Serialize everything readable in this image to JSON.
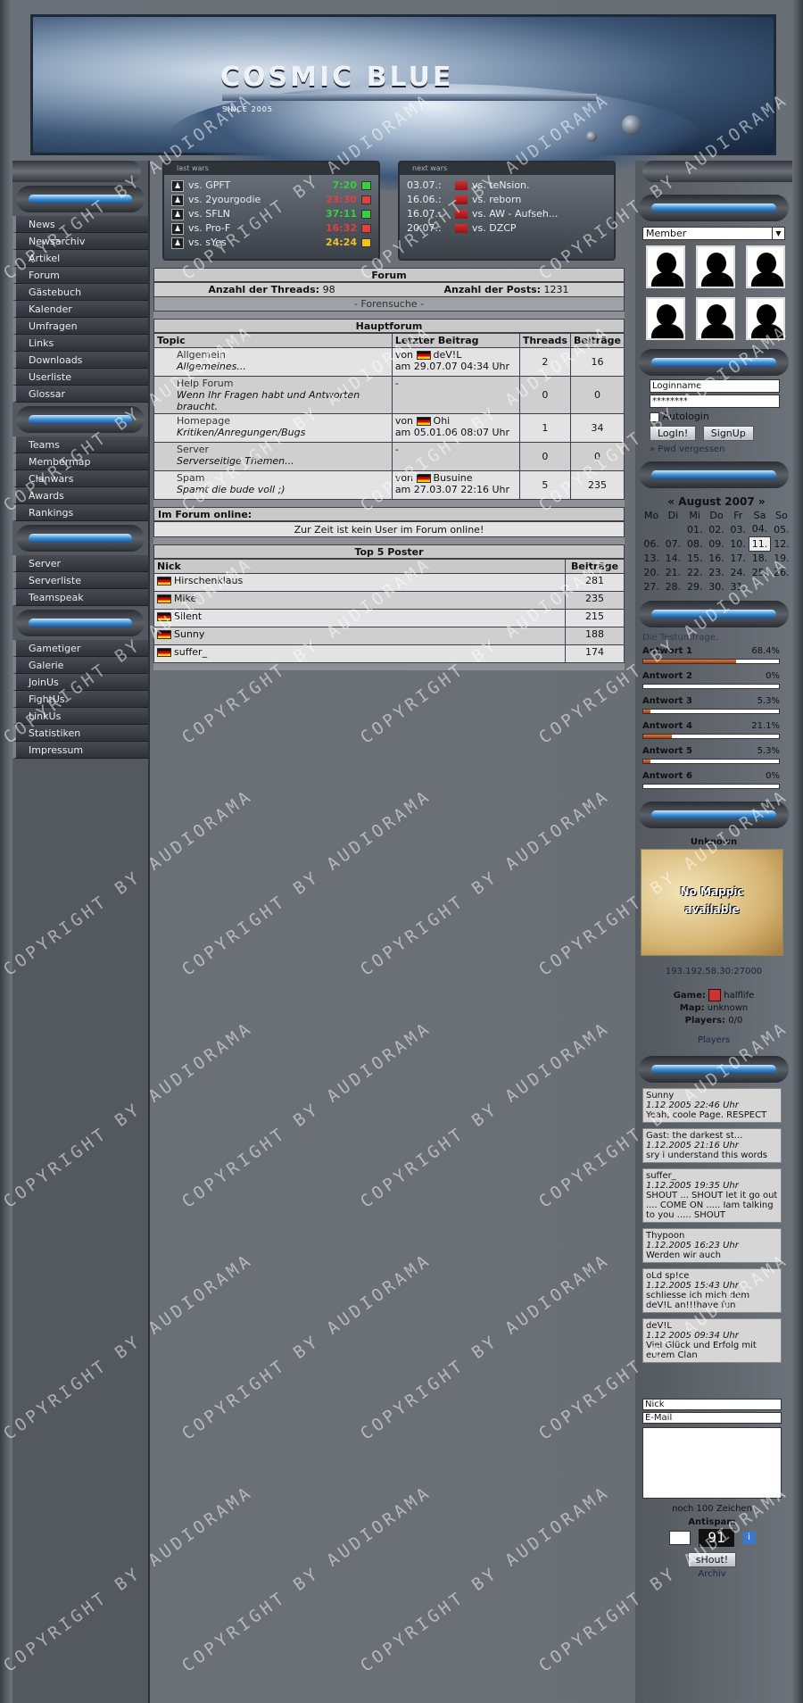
{
  "header": {
    "logo": "COSMIC BLUE",
    "since": "SINCE 2005"
  },
  "watermark": "COPYRIGHT BY AUDIORAMA",
  "left_nav_1": [
    "News",
    "Newsarchiv",
    "Artikel",
    "Forum",
    "Gästebuch",
    "Kalender",
    "Umfragen",
    "Links",
    "Downloads",
    "Userliste",
    "Glossar"
  ],
  "left_nav_2": [
    "Teams",
    "Membermap",
    "Clanwars",
    "Awards",
    "Rankings"
  ],
  "left_nav_3": [
    "Server",
    "Serverliste",
    "Teamspeak"
  ],
  "left_nav_4": [
    "Gametiger",
    "Galerie",
    "JoinUs",
    "FightUs",
    "LinkUs",
    "Statistiken",
    "Impressum"
  ],
  "last_wars": {
    "title": "last wars",
    "rows": [
      {
        "opp": "vs. GPFT",
        "score": "7:20",
        "color": "#39d03b"
      },
      {
        "opp": "vs. 2yourgodie",
        "score": "23:30",
        "color": "#e24040"
      },
      {
        "opp": "vs. SFLN",
        "score": "37:11",
        "color": "#39d03b"
      },
      {
        "opp": "vs. Pro-F",
        "score": "16:32",
        "color": "#e24040"
      },
      {
        "opp": "vs. sYes",
        "score": "24:24",
        "color": "#f0c420"
      }
    ]
  },
  "next_wars": {
    "title": "next wars",
    "rows": [
      {
        "date": "03.07.:",
        "opp": "vs. teNsion."
      },
      {
        "date": "16.06.:",
        "opp": "vs. reborn"
      },
      {
        "date": "16.07.:",
        "opp": "vs. AW - Aufseh..."
      },
      {
        "date": "20.07.:",
        "opp": "vs. DZCP"
      }
    ]
  },
  "forum": {
    "title": "Forum",
    "threads_label": "Anzahl der Threads:",
    "threads": "98",
    "posts_label": "Anzahl der Posts:",
    "posts": "1231",
    "search": "- Forensuche -",
    "main_title": "Hauptforum",
    "col_topic": "Topic",
    "col_last": "Letzter Beitrag",
    "col_threads": "Threads",
    "col_posts": "Beiträge",
    "rows": [
      {
        "name": "Allgemein",
        "desc": "Allgemeines...",
        "l1": "von",
        "user": "deV!L",
        "l2": "am 29.07.07 04:34 Uhr",
        "threads": "2",
        "posts": "16"
      },
      {
        "name": "Help Forum",
        "desc": "Wenn Ihr Fragen habt und Antworten braucht.",
        "l1": "-",
        "user": "",
        "l2": "",
        "threads": "0",
        "posts": "0"
      },
      {
        "name": "Homepage",
        "desc": "Kritiken/Anregungen/Bugs",
        "l1": "von",
        "user": "Ohi",
        "l2": "am 05.01.06 08:07 Uhr",
        "threads": "1",
        "posts": "34"
      },
      {
        "name": "Server",
        "desc": "Serverseitige Themen...",
        "l1": "-",
        "user": "",
        "l2": "",
        "threads": "0",
        "posts": "0"
      },
      {
        "name": "Spam",
        "desc": "Spamt die bude voll ;)",
        "l1": "von",
        "user": "Busuine",
        "l2": "am 27.03.07 22:16 Uhr",
        "threads": "5",
        "posts": "235"
      }
    ],
    "online_title": "Im Forum online:",
    "online_text": "Zur Zeit ist kein User im Forum online!",
    "top_title": "Top 5 Poster",
    "top_nick": "Nick",
    "top_posts": "Beiträge",
    "top": [
      {
        "nick": "Hirschenklaus",
        "posts": "281"
      },
      {
        "nick": "Mike",
        "posts": "235"
      },
      {
        "nick": "Silent",
        "posts": "215"
      },
      {
        "nick": "Sunny",
        "posts": "188"
      },
      {
        "nick": "suffer_",
        "posts": "174"
      }
    ]
  },
  "members": {
    "select": "Member"
  },
  "login": {
    "name": "Loginname",
    "pass": "********",
    "autologin": "Autologin",
    "login_btn": "LogIn!",
    "signup_btn": "SignUp",
    "forgot": "» Pwd vergessen"
  },
  "calendar": {
    "title": "« August 2007 »",
    "days": [
      "Mo",
      "Di",
      "Mi",
      "Do",
      "Fr",
      "Sa",
      "So"
    ],
    "weeks": [
      [
        "",
        "",
        "01.",
        "02.",
        "03.",
        "04.",
        "05."
      ],
      [
        "06.",
        "07.",
        "08.",
        "09.",
        "10.",
        "11.",
        "12."
      ],
      [
        "13.",
        "14.",
        "15.",
        "16.",
        "17.",
        "18.",
        "19."
      ],
      [
        "20.",
        "21.",
        "22.",
        "23.",
        "24.",
        "25.",
        "26."
      ],
      [
        "27.",
        "28.",
        "29.",
        "30.",
        "31.",
        "",
        ""
      ]
    ]
  },
  "poll": {
    "question": "Die Testumfrage.",
    "answers": [
      {
        "label": "Antwort 1",
        "pct": "68.4%",
        "value": 68.4
      },
      {
        "label": "Antwort 2",
        "pct": "0%",
        "value": 0
      },
      {
        "label": "Antwort 3",
        "pct": "5.3%",
        "value": 5.3
      },
      {
        "label": "Antwort 4",
        "pct": "21.1%",
        "value": 21.1
      },
      {
        "label": "Antwort 5",
        "pct": "5.3%",
        "value": 5.3
      },
      {
        "label": "Antwort 6",
        "pct": "0%",
        "value": 0
      }
    ]
  },
  "server": {
    "name": "Unknown",
    "map_line1": "No Mappic",
    "map_line2": "available",
    "ip": "193.192.58.30:27000",
    "game_label": "Game:",
    "game": "halflife",
    "map_label": "Map:",
    "map": "unknown",
    "players_label": "Players:",
    "players": "0/0",
    "players_link": "Players"
  },
  "shoutbox": [
    {
      "nick": "Sunny",
      "time": "1.12.2005 22:46 Uhr",
      "text": "Yeah, coole Page. RESPECT"
    },
    {
      "nick": "Gast: the darkest st...",
      "time": "1.12.2005 21:16 Uhr",
      "text": "sry i understand this words"
    },
    {
      "nick": "suffer_",
      "time": "1.12.2005 19:35 Uhr",
      "text": "SHOUT ... SHOUT let it go out .... COME ON ..... Iam talking to you ..... SHOUT"
    },
    {
      "nick": "Thypoon",
      "time": "1.12.2005 16:23 Uhr",
      "text": "Werden wir auch"
    },
    {
      "nick": "oLd sp!ce",
      "time": "1.12.2005 15:43 Uhr",
      "text": "schliesse ich mich dem deV!L an!!!have fun"
    },
    {
      "nick": "deV!L",
      "time": "1.12.2005 09:34 Uhr",
      "text": "Viel Glück und Erfolg mit eurem Clan"
    }
  ],
  "shoutform": {
    "nick": "Nick",
    "email": "E-Mail",
    "chars": "noch  100  Zeichen",
    "antispam": "Antispam",
    "captcha": "91",
    "submit": "sHout!",
    "archive": "Archiv"
  }
}
